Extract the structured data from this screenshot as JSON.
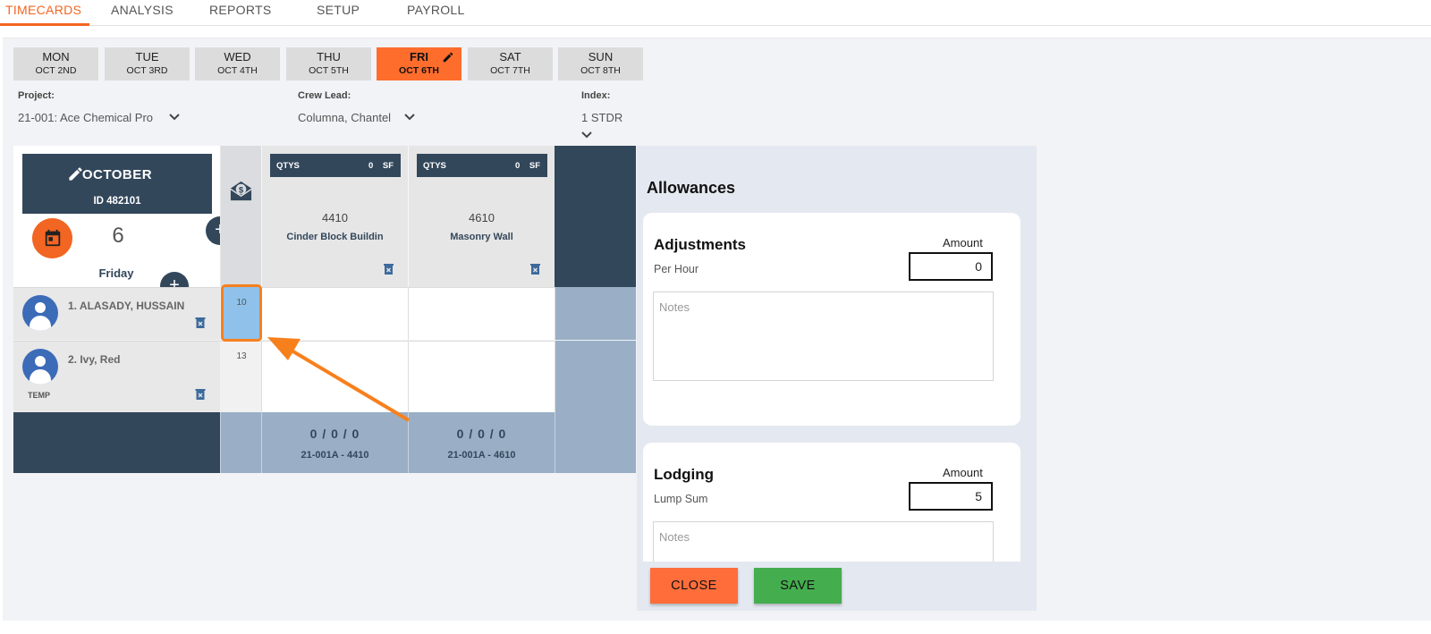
{
  "nav": {
    "tabs": [
      {
        "label": "TIMECARDS"
      },
      {
        "label": "ANALYSIS"
      },
      {
        "label": "REPORTS"
      },
      {
        "label": "SETUP"
      },
      {
        "label": "PAYROLL"
      }
    ],
    "active_color": "#f26522"
  },
  "week": [
    {
      "day": "MON",
      "date": "OCT 2ND"
    },
    {
      "day": "TUE",
      "date": "OCT 3RD"
    },
    {
      "day": "WED",
      "date": "OCT 4TH"
    },
    {
      "day": "THU",
      "date": "OCT 5TH"
    },
    {
      "day": "FRI",
      "date": "OCT 6TH"
    },
    {
      "day": "SAT",
      "date": "OCT 7TH"
    },
    {
      "day": "SUN",
      "date": "OCT 8TH"
    }
  ],
  "filters": {
    "project": {
      "label": "Project:",
      "value": "21-001: Ace Chemical Pro"
    },
    "crew_lead": {
      "label": "Crew Lead:",
      "value": "Columna, Chantel"
    },
    "index": {
      "label": "Index:",
      "value": "1 STDR"
    }
  },
  "timecard": {
    "month": "OCTOBER",
    "id_text": "ID 482101",
    "day_number": "6",
    "day_name": "Friday",
    "plus": "+"
  },
  "cost_codes": [
    {
      "qtys_label": "QTYS",
      "qty": "0",
      "unit": "SF",
      "code": "4410",
      "name": "Cinder Block Buildin",
      "totals": "0 / 0 / 0",
      "ref": "21-001A - 4410"
    },
    {
      "qtys_label": "QTYS",
      "qty": "0",
      "unit": "SF",
      "code": "4610",
      "name": "Masonry Wall",
      "totals": "0 / 0 / 0",
      "ref": "21-001A - 4610"
    }
  ],
  "employees": [
    {
      "name": "1. ALASADY, HUSSAIN",
      "hours": "10",
      "tag": ""
    },
    {
      "name": "2. Ivy, Red",
      "hours": "13",
      "tag": "TEMP"
    }
  ],
  "allowances": {
    "title": "Allowances",
    "adjustments": {
      "title": "Adjustments",
      "subtitle": "Per Hour",
      "amount_label": "Amount",
      "amount": "0",
      "notes_placeholder": "Notes"
    },
    "lodging": {
      "title": "Lodging",
      "subtitle": "Lump Sum",
      "amount_label": "Amount",
      "amount": "5",
      "notes_placeholder": "Notes"
    }
  },
  "actions": {
    "close": "CLOSE",
    "save": "SAVE"
  },
  "colors": {
    "navy": "#33475b",
    "orange": "#ff6d2d",
    "green": "#44ad4e",
    "steel": "#9aafc6",
    "highlight": "#8fc1ea"
  }
}
